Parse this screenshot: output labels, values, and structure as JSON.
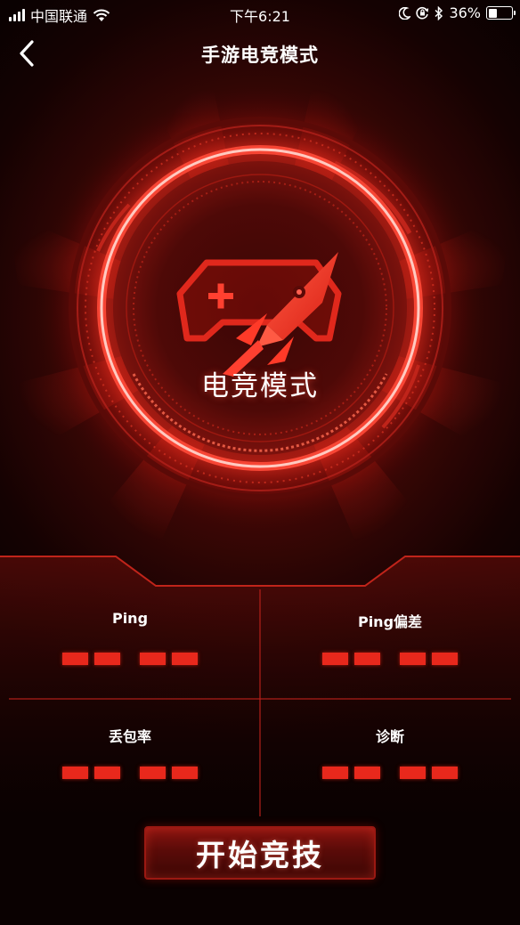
{
  "status_bar": {
    "carrier": "中国联通",
    "time": "下午6:21",
    "battery_percent_label": "36%",
    "battery_level": 0.36,
    "icons": [
      "signal-icon",
      "wifi-icon",
      "moon-icon",
      "rotation-lock-icon",
      "bluetooth-icon",
      "battery-icon"
    ]
  },
  "nav": {
    "title": "手游电竞模式",
    "back_icon": "chevron-left-icon"
  },
  "hero": {
    "mode_label": "电竞模式",
    "icon": "gamepad-rocket-icon"
  },
  "stats": [
    {
      "label": "Ping"
    },
    {
      "label": "Ping偏差"
    },
    {
      "label": "丢包率"
    },
    {
      "label": "诊断"
    }
  ],
  "start_button": {
    "label": "开始竞技"
  },
  "colors": {
    "accent": "#e8281c",
    "background_dark": "#0a0101",
    "panel_line": "#b3201a"
  }
}
